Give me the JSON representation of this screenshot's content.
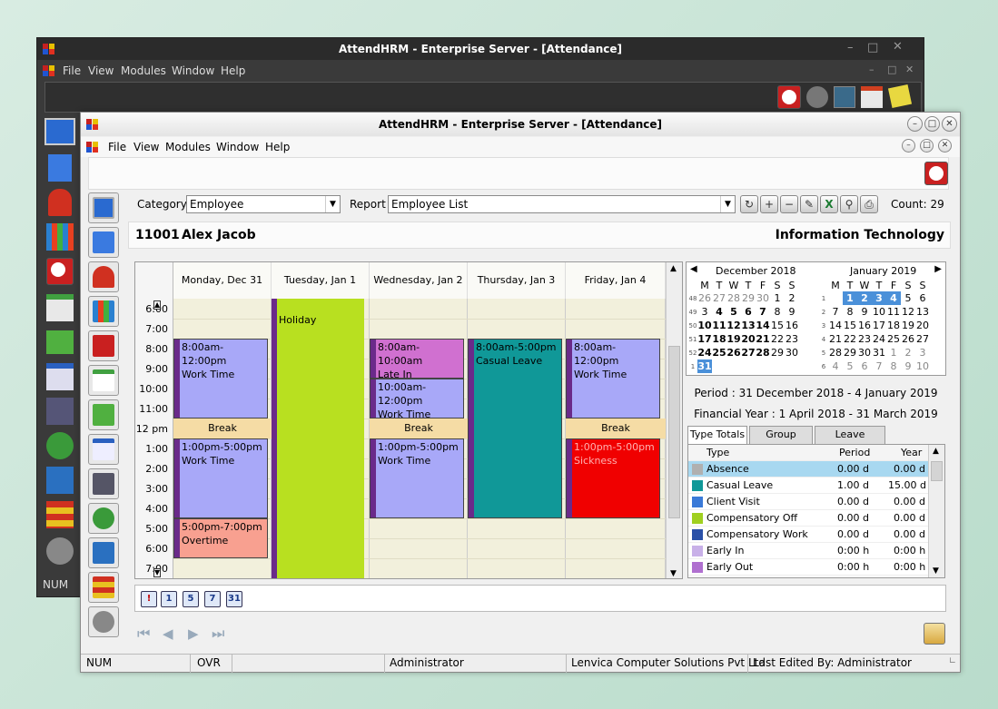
{
  "back_window": {
    "title": "AttendHRM - Enterprise Server - [Attendance]",
    "menu": [
      "File",
      "View",
      "Modules",
      "Window",
      "Help"
    ],
    "status_num": "NUM"
  },
  "front_window": {
    "title": "AttendHRM - Enterprise Server - [Attendance]",
    "menu": [
      "File",
      "View",
      "Modules",
      "Window",
      "Help"
    ]
  },
  "filters": {
    "category_label": "Category",
    "category_value": "Employee",
    "report_label": "Report",
    "report_value": "Employee List",
    "count_text": "Count: 29"
  },
  "employee": {
    "id": "11001",
    "name": "Alex Jacob",
    "department": "Information Technology"
  },
  "calendar": {
    "days": [
      "Monday, Dec 31",
      "Tuesday, Jan 1",
      "Wednesday, Jan 2",
      "Thursday, Jan 3",
      "Friday, Jan 4"
    ],
    "times": [
      "6:00",
      "7:00",
      "8:00",
      "9:00",
      "10:00",
      "11:00",
      "12 pm",
      "1:00",
      "2:00",
      "3:00",
      "4:00",
      "5:00",
      "6:00",
      "7:00"
    ],
    "events": [
      {
        "time": "8:00am-12:00pm",
        "label": "Work Time",
        "color": "#a8a8f8"
      },
      {
        "time": "1:00pm-5:00pm",
        "label": "Work Time",
        "color": "#a8a8f8"
      },
      {
        "time": "5:00pm-7:00pm",
        "label": "Overtime",
        "color": "#f8a090"
      },
      {
        "time": "",
        "label": "Holiday",
        "color": "#b8e020"
      },
      {
        "time": "8:00am-10:00am",
        "label": "Late In",
        "color": "#d070d0"
      },
      {
        "time": "10:00am-12:00pm",
        "label": "Work Time",
        "color": "#a8a8f8"
      },
      {
        "time": "1:00pm-5:00pm",
        "label": "Work Time",
        "color": "#a8a8f8"
      },
      {
        "time": "8:00am-5:00pm",
        "label": "Casual Leave",
        "color": "#109898"
      },
      {
        "time": "8:00am-12:00pm",
        "label": "Work Time",
        "color": "#a8a8f8"
      },
      {
        "time": "1:00pm-5:00pm",
        "label": "Sickness",
        "color": "#f00000"
      }
    ],
    "break_label": "Break"
  },
  "mini_calendar": {
    "month1": "December 2018",
    "month2": "January 2019",
    "weekday_headers": [
      "M",
      "T",
      "W",
      "T",
      "F",
      "S",
      "S"
    ]
  },
  "period": {
    "period_text": "Period : 31 December 2018 - 4 January 2019",
    "fy_text": "Financial Year : 1 April 2018 - 31 March 2019"
  },
  "tabs": [
    "Type Totals",
    "Group Totals",
    "Leave Balance"
  ],
  "totals": {
    "headers": [
      "Type",
      "Period",
      "Year"
    ],
    "rows": [
      {
        "type": "Absence",
        "period": "0.00 d",
        "year": "0.00 d",
        "color": "#b0b0b0"
      },
      {
        "type": "Casual Leave",
        "period": "1.00 d",
        "year": "15.00 d",
        "color": "#109898"
      },
      {
        "type": "Client Visit",
        "period": "0.00 d",
        "year": "0.00 d",
        "color": "#3a7ad8"
      },
      {
        "type": "Compensatory Off",
        "period": "0.00 d",
        "year": "0.00 d",
        "color": "#a0d020"
      },
      {
        "type": "Compensatory Work",
        "period": "0.00 d",
        "year": "0.00 d",
        "color": "#2a50a8"
      },
      {
        "type": "Early In",
        "period": "0:00 h",
        "year": "0:00 h",
        "color": "#c8b0e8"
      },
      {
        "type": "Early Out",
        "period": "0:00 h",
        "year": "0:00 h",
        "color": "#b070d0"
      }
    ]
  },
  "view_buttons": [
    "!",
    "1",
    "5",
    "7",
    "31"
  ],
  "status_bar": {
    "num": "NUM",
    "ovr": "OVR",
    "user": "Administrator",
    "company": "Lenvica Computer Solutions Pvt Ltd",
    "last_edited": "Last Edited By: Administrator"
  }
}
